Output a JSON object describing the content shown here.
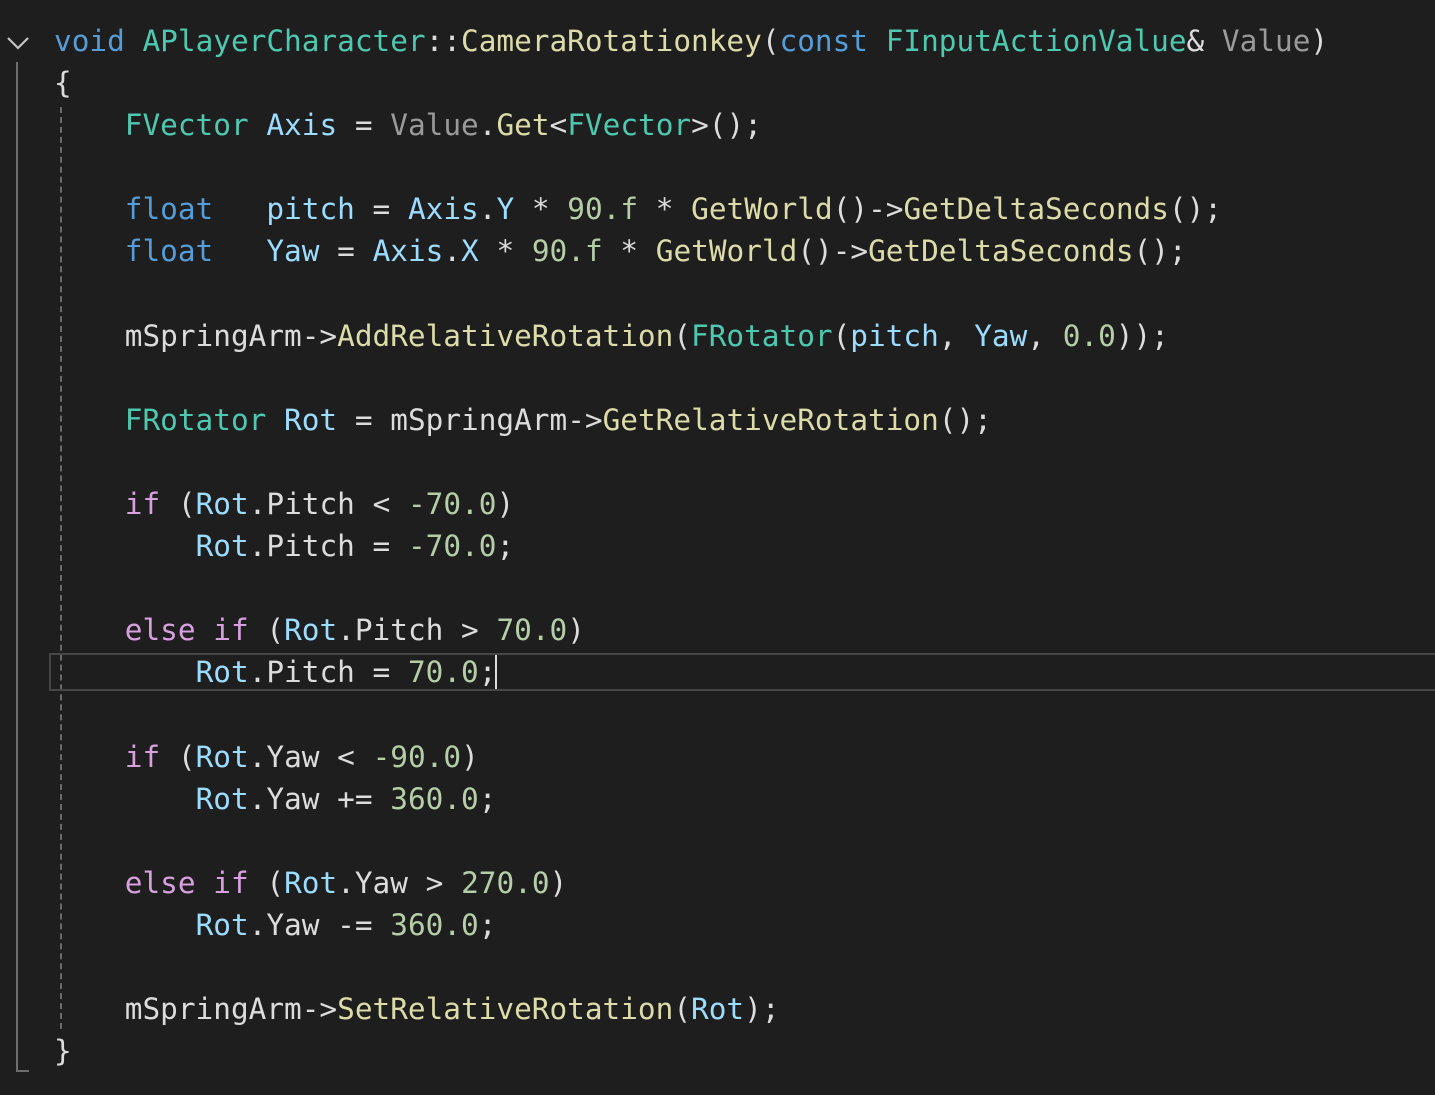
{
  "editor": {
    "theme": {
      "background": "#1e1e1e",
      "keyword": "#569cd6",
      "control": "#d8a0df",
      "type": "#4ec9b0",
      "function": "#dcdcaa",
      "variable": "#9cdcfe",
      "parameter": "#9a9a9a",
      "number": "#b5cea8",
      "punctuation": "#dcdcdc"
    },
    "fold_icon": "chevron-down-icon",
    "current_line": 16,
    "lines": [
      [
        [
          "keyword",
          "void"
        ],
        [
          "plain",
          " "
        ],
        [
          "type",
          "APlayerCharacter"
        ],
        [
          "punct",
          "::"
        ],
        [
          "function",
          "CameraRotationkey"
        ],
        [
          "punct",
          "("
        ],
        [
          "keyword",
          "const"
        ],
        [
          "plain",
          " "
        ],
        [
          "type",
          "FInputActionValue"
        ],
        [
          "punct",
          "&"
        ],
        [
          "plain",
          " "
        ],
        [
          "param",
          "Value"
        ],
        [
          "punct",
          ")"
        ]
      ],
      [
        [
          "punct",
          "{"
        ]
      ],
      [
        [
          "plain",
          "    "
        ],
        [
          "type",
          "FVector"
        ],
        [
          "plain",
          " "
        ],
        [
          "variable",
          "Axis"
        ],
        [
          "plain",
          " "
        ],
        [
          "punct",
          "="
        ],
        [
          "plain",
          " "
        ],
        [
          "param",
          "Value"
        ],
        [
          "punct",
          "."
        ],
        [
          "function",
          "Get"
        ],
        [
          "punct",
          "<"
        ],
        [
          "type",
          "FVector"
        ],
        [
          "punct",
          ">();"
        ]
      ],
      [],
      [
        [
          "plain",
          "    "
        ],
        [
          "keyword",
          "float"
        ],
        [
          "plain",
          "   "
        ],
        [
          "variable",
          "pitch"
        ],
        [
          "plain",
          " "
        ],
        [
          "punct",
          "="
        ],
        [
          "plain",
          " "
        ],
        [
          "variable",
          "Axis"
        ],
        [
          "punct",
          "."
        ],
        [
          "variable",
          "Y"
        ],
        [
          "plain",
          " "
        ],
        [
          "punct",
          "*"
        ],
        [
          "plain",
          " "
        ],
        [
          "number",
          "90.f"
        ],
        [
          "plain",
          " "
        ],
        [
          "punct",
          "*"
        ],
        [
          "plain",
          " "
        ],
        [
          "function",
          "GetWorld"
        ],
        [
          "punct",
          "()->"
        ],
        [
          "function",
          "GetDeltaSeconds"
        ],
        [
          "punct",
          "();"
        ]
      ],
      [
        [
          "plain",
          "    "
        ],
        [
          "keyword",
          "float"
        ],
        [
          "plain",
          "   "
        ],
        [
          "variable",
          "Yaw"
        ],
        [
          "plain",
          " "
        ],
        [
          "punct",
          "="
        ],
        [
          "plain",
          " "
        ],
        [
          "variable",
          "Axis"
        ],
        [
          "punct",
          "."
        ],
        [
          "variable",
          "X"
        ],
        [
          "plain",
          " "
        ],
        [
          "punct",
          "*"
        ],
        [
          "plain",
          " "
        ],
        [
          "number",
          "90.f"
        ],
        [
          "plain",
          " "
        ],
        [
          "punct",
          "*"
        ],
        [
          "plain",
          " "
        ],
        [
          "function",
          "GetWorld"
        ],
        [
          "punct",
          "()->"
        ],
        [
          "function",
          "GetDeltaSeconds"
        ],
        [
          "punct",
          "();"
        ]
      ],
      [],
      [
        [
          "plain",
          "    "
        ],
        [
          "plain",
          "mSpringArm"
        ],
        [
          "punct",
          "->"
        ],
        [
          "function",
          "AddRelativeRotation"
        ],
        [
          "punct",
          "("
        ],
        [
          "type",
          "FRotator"
        ],
        [
          "punct",
          "("
        ],
        [
          "variable",
          "pitch"
        ],
        [
          "punct",
          ","
        ],
        [
          "plain",
          " "
        ],
        [
          "variable",
          "Yaw"
        ],
        [
          "punct",
          ","
        ],
        [
          "plain",
          " "
        ],
        [
          "number",
          "0.0"
        ],
        [
          "punct",
          "));"
        ]
      ],
      [],
      [
        [
          "plain",
          "    "
        ],
        [
          "type",
          "FRotator"
        ],
        [
          "plain",
          " "
        ],
        [
          "variable",
          "Rot"
        ],
        [
          "plain",
          " "
        ],
        [
          "punct",
          "="
        ],
        [
          "plain",
          " "
        ],
        [
          "plain",
          "mSpringArm"
        ],
        [
          "punct",
          "->"
        ],
        [
          "function",
          "GetRelativeRotation"
        ],
        [
          "punct",
          "();"
        ]
      ],
      [],
      [
        [
          "plain",
          "    "
        ],
        [
          "control",
          "if"
        ],
        [
          "plain",
          " "
        ],
        [
          "punct",
          "("
        ],
        [
          "variable",
          "Rot"
        ],
        [
          "punct",
          "."
        ],
        [
          "plain",
          "Pitch"
        ],
        [
          "plain",
          " "
        ],
        [
          "punct",
          "<"
        ],
        [
          "plain",
          " "
        ],
        [
          "number",
          "-70.0"
        ],
        [
          "punct",
          ")"
        ]
      ],
      [
        [
          "plain",
          "        "
        ],
        [
          "variable",
          "Rot"
        ],
        [
          "punct",
          "."
        ],
        [
          "plain",
          "Pitch"
        ],
        [
          "plain",
          " "
        ],
        [
          "punct",
          "="
        ],
        [
          "plain",
          " "
        ],
        [
          "number",
          "-70.0"
        ],
        [
          "punct",
          ";"
        ]
      ],
      [],
      [
        [
          "plain",
          "    "
        ],
        [
          "control",
          "else"
        ],
        [
          "plain",
          " "
        ],
        [
          "control",
          "if"
        ],
        [
          "plain",
          " "
        ],
        [
          "punct",
          "("
        ],
        [
          "variable",
          "Rot"
        ],
        [
          "punct",
          "."
        ],
        [
          "plain",
          "Pitch"
        ],
        [
          "plain",
          " "
        ],
        [
          "punct",
          ">"
        ],
        [
          "plain",
          " "
        ],
        [
          "number",
          "70.0"
        ],
        [
          "punct",
          ")"
        ]
      ],
      [
        [
          "plain",
          "        "
        ],
        [
          "variable",
          "Rot"
        ],
        [
          "punct",
          "."
        ],
        [
          "plain",
          "Pitch"
        ],
        [
          "plain",
          " "
        ],
        [
          "punct",
          "="
        ],
        [
          "plain",
          " "
        ],
        [
          "number",
          "70.0"
        ],
        [
          "punct",
          ";"
        ]
      ],
      [],
      [
        [
          "plain",
          "    "
        ],
        [
          "control",
          "if"
        ],
        [
          "plain",
          " "
        ],
        [
          "punct",
          "("
        ],
        [
          "variable",
          "Rot"
        ],
        [
          "punct",
          "."
        ],
        [
          "plain",
          "Yaw"
        ],
        [
          "plain",
          " "
        ],
        [
          "punct",
          "<"
        ],
        [
          "plain",
          " "
        ],
        [
          "number",
          "-90.0"
        ],
        [
          "punct",
          ")"
        ]
      ],
      [
        [
          "plain",
          "        "
        ],
        [
          "variable",
          "Rot"
        ],
        [
          "punct",
          "."
        ],
        [
          "plain",
          "Yaw"
        ],
        [
          "plain",
          " "
        ],
        [
          "punct",
          "+="
        ],
        [
          "plain",
          " "
        ],
        [
          "number",
          "360.0"
        ],
        [
          "punct",
          ";"
        ]
      ],
      [],
      [
        [
          "plain",
          "    "
        ],
        [
          "control",
          "else"
        ],
        [
          "plain",
          " "
        ],
        [
          "control",
          "if"
        ],
        [
          "plain",
          " "
        ],
        [
          "punct",
          "("
        ],
        [
          "variable",
          "Rot"
        ],
        [
          "punct",
          "."
        ],
        [
          "plain",
          "Yaw"
        ],
        [
          "plain",
          " "
        ],
        [
          "punct",
          ">"
        ],
        [
          "plain",
          " "
        ],
        [
          "number",
          "270.0"
        ],
        [
          "punct",
          ")"
        ]
      ],
      [
        [
          "plain",
          "        "
        ],
        [
          "variable",
          "Rot"
        ],
        [
          "punct",
          "."
        ],
        [
          "plain",
          "Yaw"
        ],
        [
          "plain",
          " "
        ],
        [
          "punct",
          "-="
        ],
        [
          "plain",
          " "
        ],
        [
          "number",
          "360.0"
        ],
        [
          "punct",
          ";"
        ]
      ],
      [],
      [
        [
          "plain",
          "    "
        ],
        [
          "plain",
          "mSpringArm"
        ],
        [
          "punct",
          "->"
        ],
        [
          "function",
          "SetRelativeRotation"
        ],
        [
          "punct",
          "("
        ],
        [
          "variable",
          "Rot"
        ],
        [
          "punct",
          ");"
        ]
      ],
      [
        [
          "punct",
          "}"
        ]
      ]
    ]
  }
}
